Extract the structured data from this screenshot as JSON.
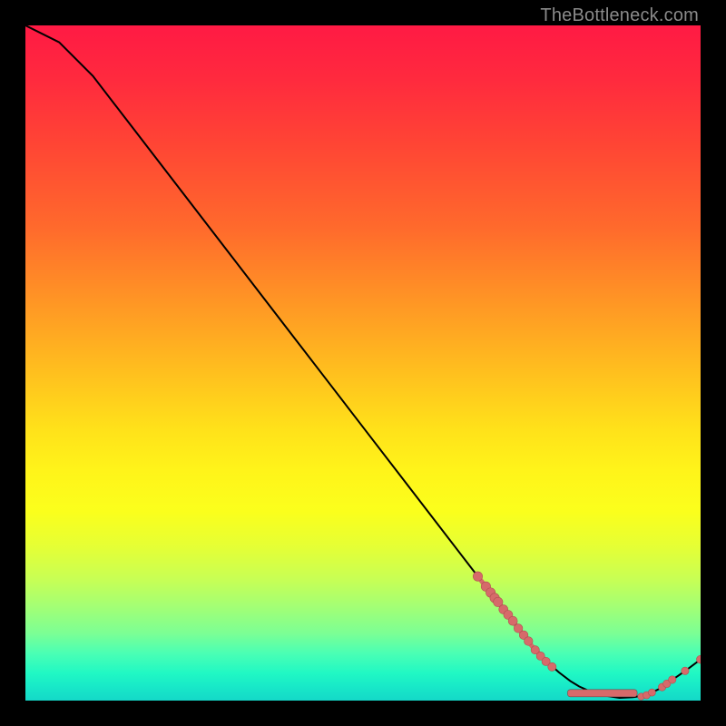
{
  "watermark": "TheBottleneck.com",
  "colors": {
    "curve": "#000000",
    "dot_fill": "#d66a6a",
    "dot_stroke": "#b25050",
    "cluster_fill": "#d66a6a",
    "cluster_stroke": "#6a4f4f"
  },
  "chart_data": {
    "type": "line",
    "title": "",
    "xlabel": "",
    "ylabel": "",
    "xlim": [
      0,
      100
    ],
    "ylim": [
      0,
      100
    ],
    "grid": false,
    "legend": false,
    "curve": [
      [
        0,
        100
      ],
      [
        5,
        97.5
      ],
      [
        10,
        92.5
      ],
      [
        15,
        86
      ],
      [
        20,
        79.5
      ],
      [
        25,
        73
      ],
      [
        30,
        66.5
      ],
      [
        35,
        60
      ],
      [
        40,
        53.5
      ],
      [
        45,
        47
      ],
      [
        50,
        40.5
      ],
      [
        55,
        34
      ],
      [
        60,
        27.5
      ],
      [
        65,
        21
      ],
      [
        67,
        18.4
      ],
      [
        70,
        14.6
      ],
      [
        73,
        10.7
      ],
      [
        75,
        8.1
      ],
      [
        77,
        6
      ],
      [
        79,
        4.2
      ],
      [
        80.7,
        2.9
      ],
      [
        82,
        2.1
      ],
      [
        84,
        1.2
      ],
      [
        86,
        0.7
      ],
      [
        88,
        0.4
      ],
      [
        90,
        0.5
      ],
      [
        92,
        0.8
      ],
      [
        94,
        1.8
      ],
      [
        96,
        3.2
      ],
      [
        98,
        4.6
      ],
      [
        100,
        6.1
      ]
    ],
    "segment_highlight": {
      "x0": 67,
      "x1": 78,
      "thickness": 5,
      "color": "#d66a6a"
    },
    "bottom_cluster": {
      "x0": 80.7,
      "x1": 90.2,
      "y": 1.1
    },
    "series": [
      {
        "name": "highlighted-dots",
        "kind": "scatter",
        "points": [
          [
            67.0,
            18.4,
            5.2
          ],
          [
            68.2,
            16.9,
            5.2
          ],
          [
            68.9,
            16.0,
            5.2
          ],
          [
            69.5,
            15.2,
            5.2
          ],
          [
            70.0,
            14.6,
            5.2
          ],
          [
            70.8,
            13.5,
            5.0
          ],
          [
            71.5,
            12.7,
            5.0
          ],
          [
            72.2,
            11.8,
            5.0
          ],
          [
            73.0,
            10.7,
            4.8
          ],
          [
            73.8,
            9.7,
            4.8
          ],
          [
            74.5,
            8.8,
            4.8
          ],
          [
            75.5,
            7.5,
            4.6
          ],
          [
            76.3,
            6.6,
            4.6
          ],
          [
            77.1,
            5.8,
            4.6
          ],
          [
            78.0,
            5.0,
            4.6
          ],
          [
            91.2,
            0.6,
            3.8
          ],
          [
            92.0,
            0.8,
            4.0
          ],
          [
            92.8,
            1.2,
            4.0
          ],
          [
            94.3,
            2.0,
            4.2
          ],
          [
            95.0,
            2.5,
            4.2
          ],
          [
            95.8,
            3.1,
            4.2
          ],
          [
            97.7,
            4.4,
            4.2
          ],
          [
            100.0,
            6.1,
            4.5
          ]
        ]
      }
    ]
  }
}
